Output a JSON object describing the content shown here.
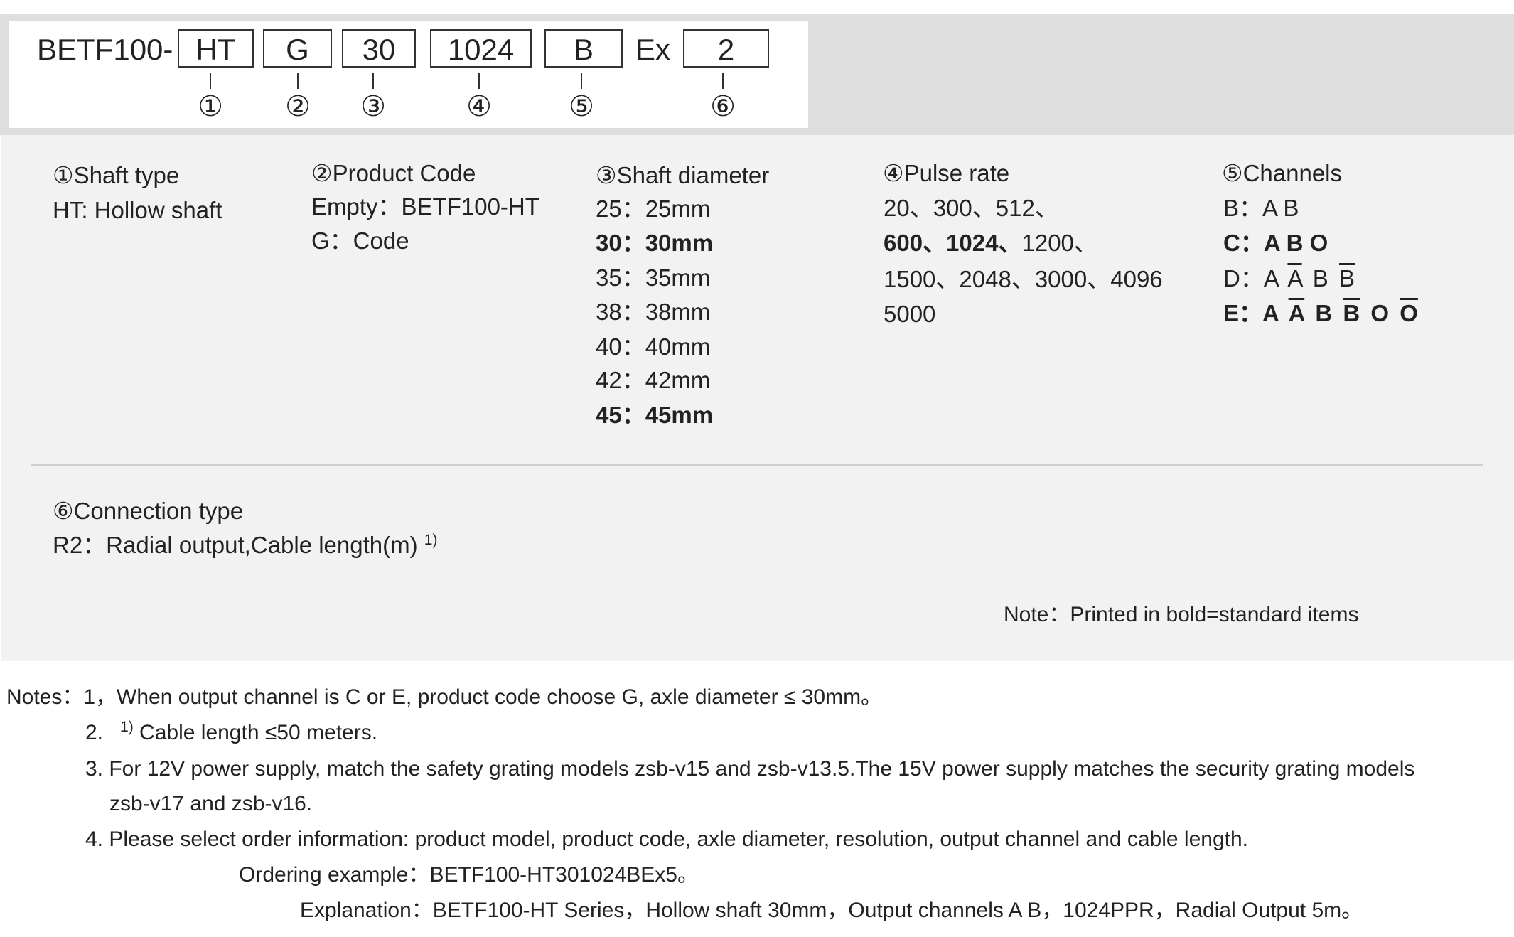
{
  "model_code": {
    "prefix": "BETF100-",
    "boxes": [
      "HT",
      "G",
      "30",
      "1024",
      "B",
      "2"
    ],
    "ex_label": "Ex",
    "markers": [
      "①",
      "②",
      "③",
      "④",
      "⑤",
      "⑥"
    ]
  },
  "shaft_type": {
    "title": "①Shaft type",
    "lines": [
      "HT: Hollow shaft"
    ]
  },
  "product_code": {
    "title": "②Product Code",
    "lines": [
      "Empty：BETF100-HT",
      "G：Code"
    ]
  },
  "shaft_diameter": {
    "title": "③Shaft diameter",
    "lines": [
      "25：25mm",
      "30：30mm",
      "35：35mm",
      "38：38mm",
      "40：40mm",
      "42：42mm",
      "45：45mm"
    ]
  },
  "pulse_rate": {
    "title": "④Pulse rate",
    "line1": "20、300、512、",
    "line2_bold": "600、1024、",
    "line2_rest": "1200、",
    "line3": "1500、2048、3000、4096",
    "line4": "5000"
  },
  "channels": {
    "title": "⑤Channels",
    "b": {
      "key": "B：",
      "signals": "A B"
    },
    "c": {
      "key": "C：",
      "signals": "A B O"
    },
    "d": {
      "key": "D：",
      "s1": "A",
      "s2": "A",
      "s3": "B",
      "s4": "B"
    },
    "e": {
      "key": "E：",
      "s1": "A",
      "s2": "A",
      "s3": "B",
      "s4": "B",
      "s5": "O",
      "s6": "O"
    }
  },
  "connection_type": {
    "title": "⑥Connection type",
    "line": "R2：Radial output,Cable length(m)",
    "footnote_mark": "1)"
  },
  "bold_note": "Note：Printed in bold=standard items",
  "notes": {
    "label": "Notes：",
    "n1": "1，When output channel is C or E, product code choose G, axle diameter ≤ 30mm。",
    "n2_num": "2.",
    "n2_mark": "1)",
    "n2_text": " Cable length ≤50 meters.",
    "n3a": "3. For 12V power supply, match the safety grating models zsb-v15 and zsb-v13.5.The 15V power supply matches the security grating models",
    "n3b": "zsb-v17 and zsb-v16.",
    "n4": "4. Please select order information: product model, product code, axle diameter, resolution, output channel and cable length.",
    "example": "Ordering example：BETF100-HT301024BEx5。",
    "explanation": "Explanation：BETF100-HT Series，Hollow shaft 30mm，Output channels A B，1024PPR，Radial Output 5m。"
  }
}
